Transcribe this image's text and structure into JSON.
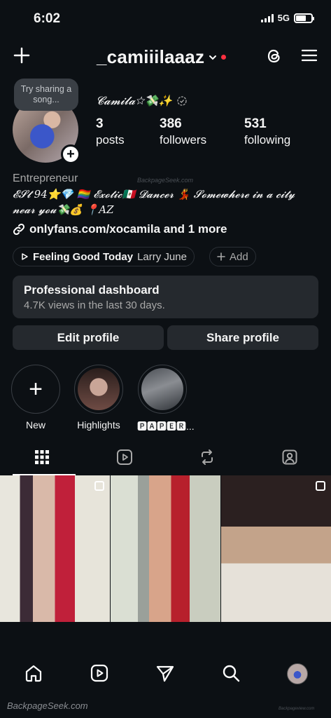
{
  "status": {
    "time": "6:02",
    "network": "5G"
  },
  "header": {
    "username": "_camiiilaaaz"
  },
  "profile": {
    "note": "Try sharing a song...",
    "display_name": "𝓒𝓪𝓶𝓲𝓵𝓪☆💸✨",
    "stats": [
      {
        "value": "3",
        "label": "posts"
      },
      {
        "value": "386",
        "label": "followers"
      },
      {
        "value": "531",
        "label": "following"
      }
    ],
    "category": "Entrepreneur",
    "bio": "𝓔𝓢𝓽 94⭐💎 🏳️‍🌈 𝓔𝔁𝓸𝓽𝓲𝓬🇲🇽 𝓓𝓪𝓷𝓬𝓮𝓻 💃 𝓢𝓸𝓶𝓮𝔀𝓱𝓮𝓻𝓮 𝓲𝓷 𝓪 𝓬𝓲𝓽𝔂 𝓷𝓮𝓪𝓻 𝔂𝓸𝓾💸💰 📍AZ",
    "link": "onlyfans.com/xocamila and 1 more"
  },
  "music": {
    "song": "Feeling Good Today",
    "artist": "Larry June",
    "add_label": "Add"
  },
  "dashboard": {
    "title": "Professional dashboard",
    "subtitle": "4.7K views in the last 30 days."
  },
  "buttons": {
    "edit": "Edit profile",
    "share": "Share profile"
  },
  "highlights": [
    {
      "label": "New"
    },
    {
      "label": "Highlights"
    },
    {
      "label": "🅿🅰🅿🅴🆁..."
    }
  ],
  "watermarks": {
    "mid": "BackpageSeek.com",
    "bottom": "BackpageSeek.com",
    "corner": "Backpageview.com"
  },
  "colors": {
    "background": "#0c1014",
    "card": "#25292e",
    "notification_dot": "#ff3040"
  }
}
